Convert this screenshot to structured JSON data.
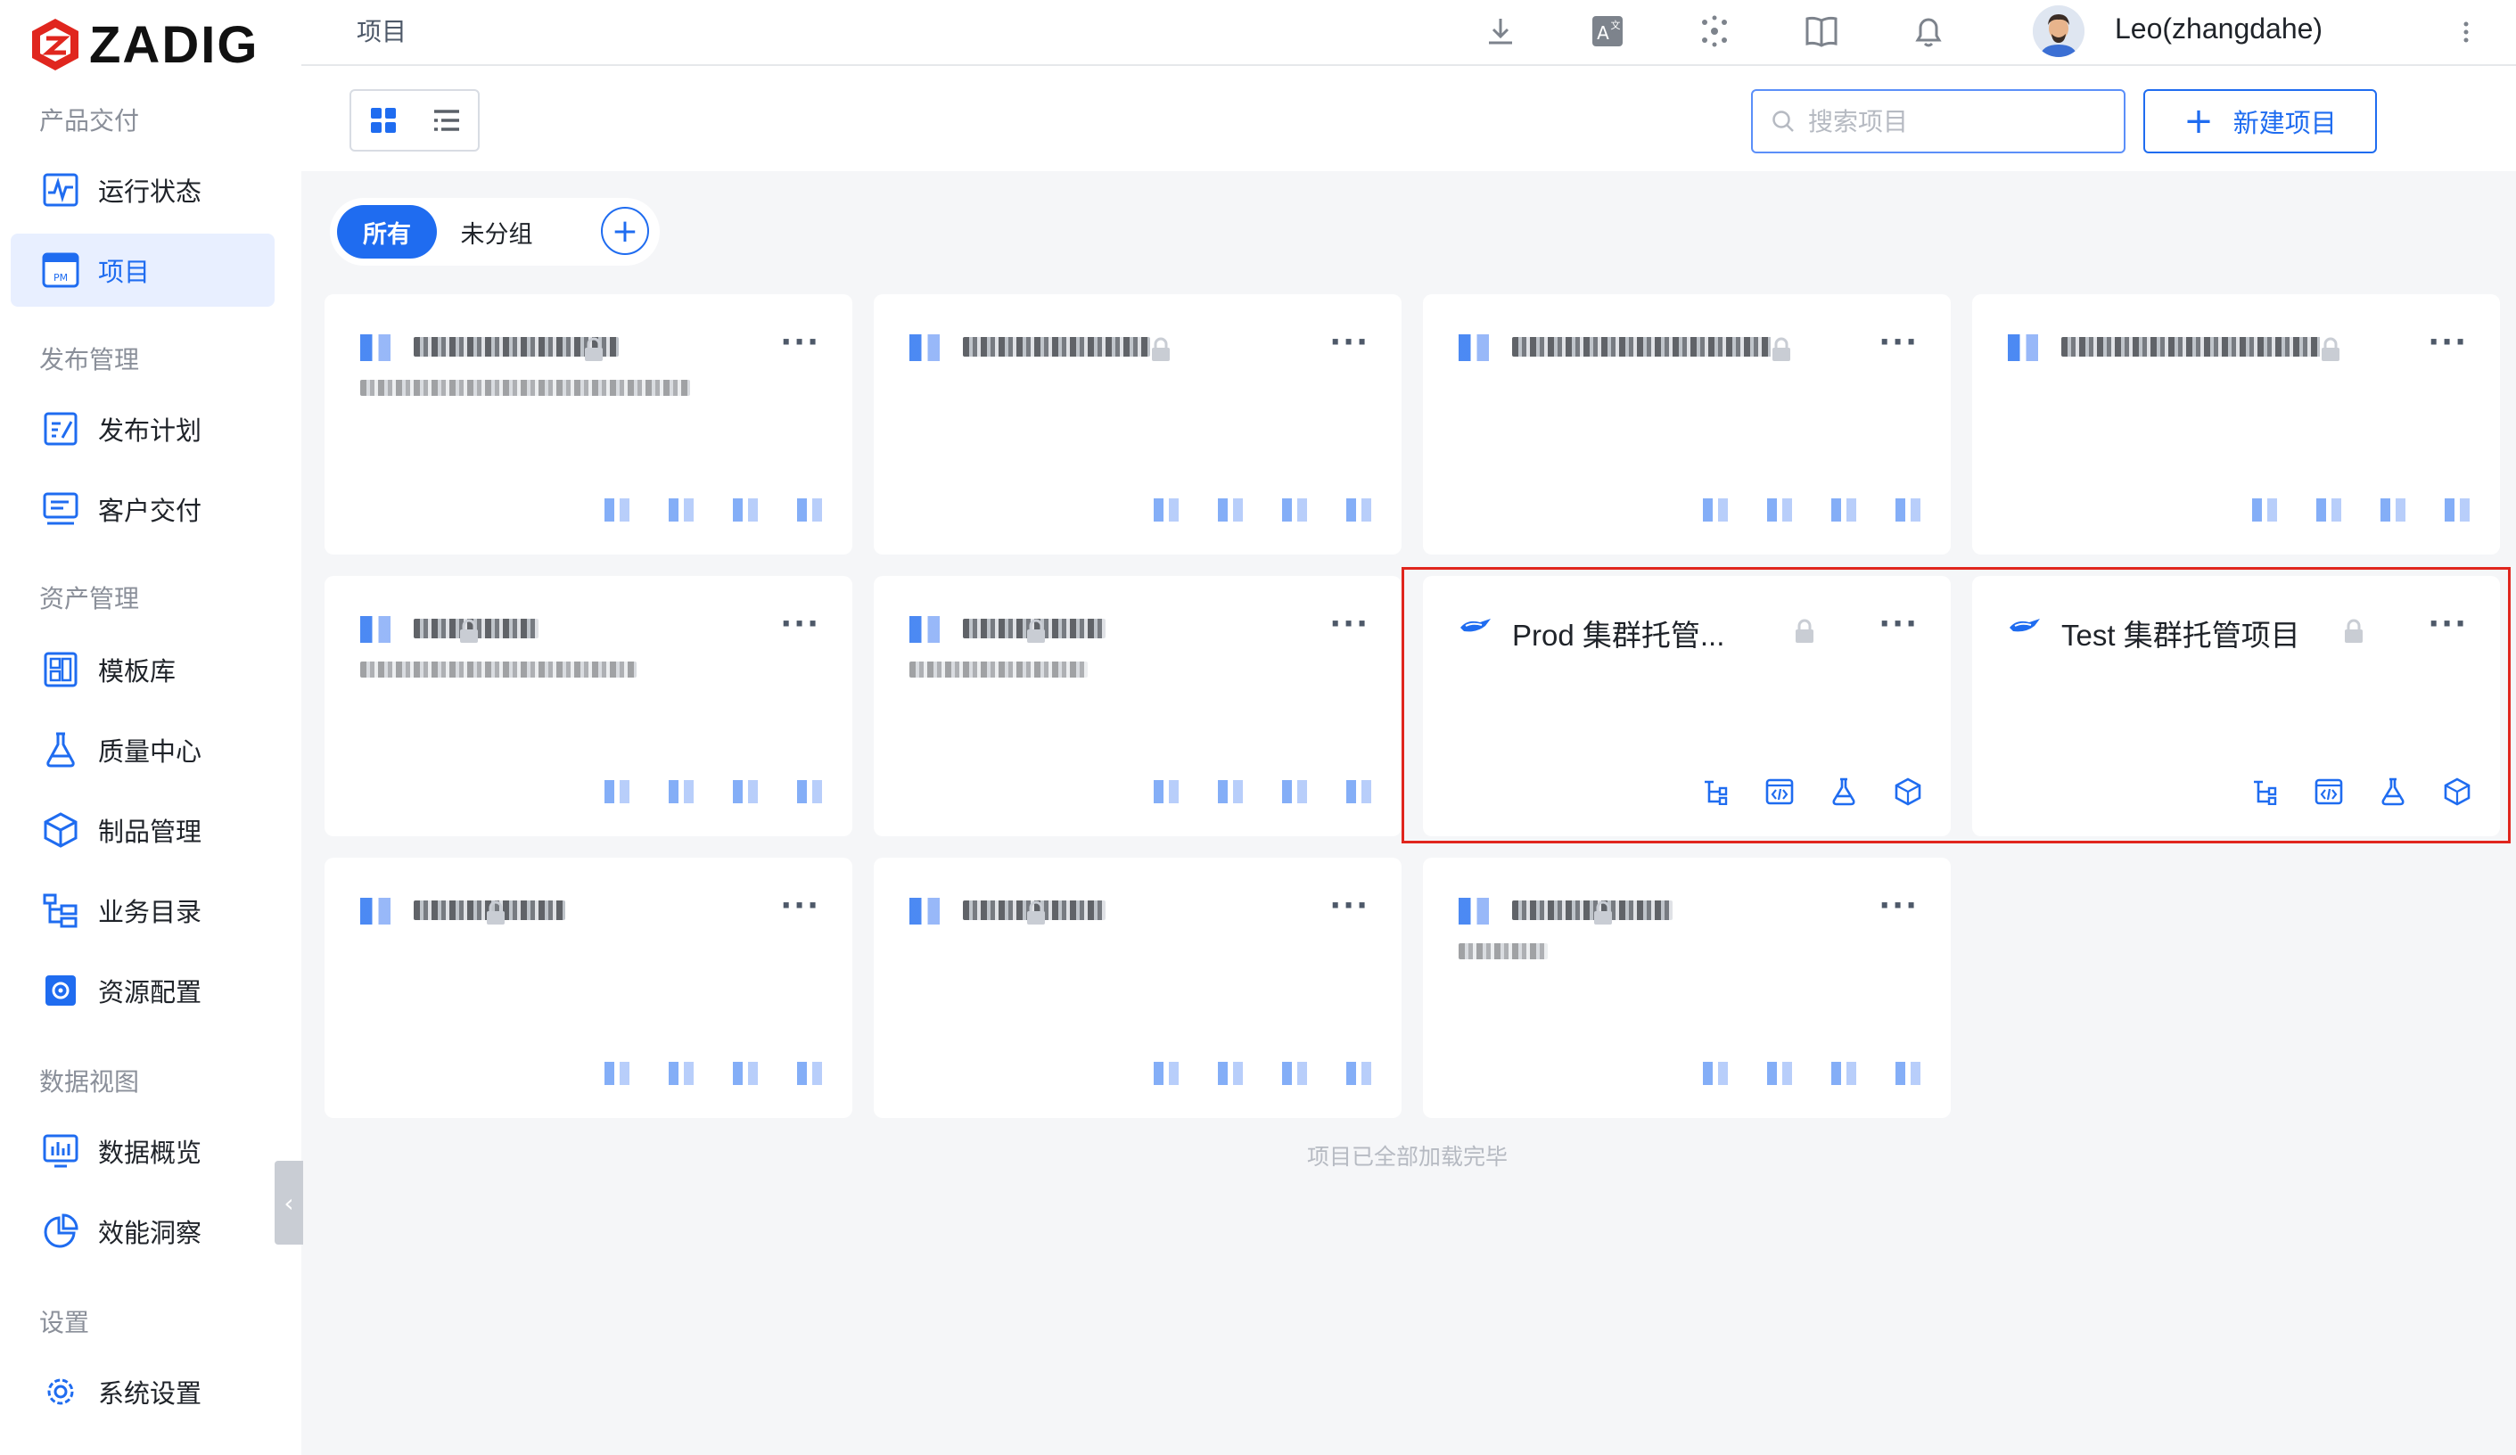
{
  "app": {
    "logo_text": "ZADIG",
    "brand_color": "#e0261e",
    "accent_color": "#1f6cf0"
  },
  "sidebar": {
    "sections": [
      {
        "title": "产品交付",
        "items": [
          {
            "label": "运行状态",
            "icon": "pulse-monitor-icon",
            "active": false
          },
          {
            "label": "项目",
            "icon": "project-pm-icon",
            "active": true
          }
        ]
      },
      {
        "title": "发布管理",
        "items": [
          {
            "label": "发布计划",
            "icon": "release-plan-icon",
            "active": false
          },
          {
            "label": "客户交付",
            "icon": "customer-delivery-icon",
            "active": false
          }
        ]
      },
      {
        "title": "资产管理",
        "items": [
          {
            "label": "模板库",
            "icon": "template-library-icon",
            "active": false
          },
          {
            "label": "质量中心",
            "icon": "flask-icon",
            "active": false
          },
          {
            "label": "制品管理",
            "icon": "artifact-box-icon",
            "active": false
          },
          {
            "label": "业务目录",
            "icon": "catalog-tree-icon",
            "active": false
          },
          {
            "label": "资源配置",
            "icon": "resource-gear-icon",
            "active": false
          }
        ]
      },
      {
        "title": "数据视图",
        "items": [
          {
            "label": "数据概览",
            "icon": "bar-chart-icon",
            "active": false
          },
          {
            "label": "效能洞察",
            "icon": "pie-chart-icon",
            "active": false
          }
        ]
      },
      {
        "title": "设置",
        "items": [
          {
            "label": "系统设置",
            "icon": "settings-gear-icon",
            "active": false
          }
        ]
      }
    ]
  },
  "topbar": {
    "breadcrumb": "项目",
    "username": "Leo(zhangdahe)"
  },
  "toolbar": {
    "search_placeholder": "搜索项目",
    "new_project_label": "新建项目"
  },
  "groups": {
    "tabs": [
      {
        "label": "所有",
        "active": true
      },
      {
        "label": "未分组",
        "active": false
      }
    ]
  },
  "projects": [
    {
      "title": "",
      "blurred": true,
      "has_desc": true
    },
    {
      "title": "",
      "blurred": true,
      "has_desc": false
    },
    {
      "title": "",
      "blurred": true,
      "has_desc": false
    },
    {
      "title": "",
      "blurred": true,
      "has_desc": false
    },
    {
      "title": "",
      "blurred": true,
      "has_desc": true
    },
    {
      "title": "",
      "blurred": true,
      "has_desc": true
    },
    {
      "title": "Prod 集群托管...",
      "blurred": false,
      "has_desc": false,
      "highlighted": true
    },
    {
      "title": "Test 集群托管项目",
      "blurred": false,
      "has_desc": false,
      "highlighted": true
    },
    {
      "title": "",
      "blurred": true,
      "has_desc": false
    },
    {
      "title": "",
      "blurred": true,
      "has_desc": false
    },
    {
      "title": "",
      "blurred": true,
      "has_desc": true
    }
  ],
  "card_actions": [
    "workflow-tree-icon",
    "code-window-icon",
    "flask-icon",
    "cube-icon"
  ],
  "footer": {
    "message": "项目已全部加载完毕"
  }
}
